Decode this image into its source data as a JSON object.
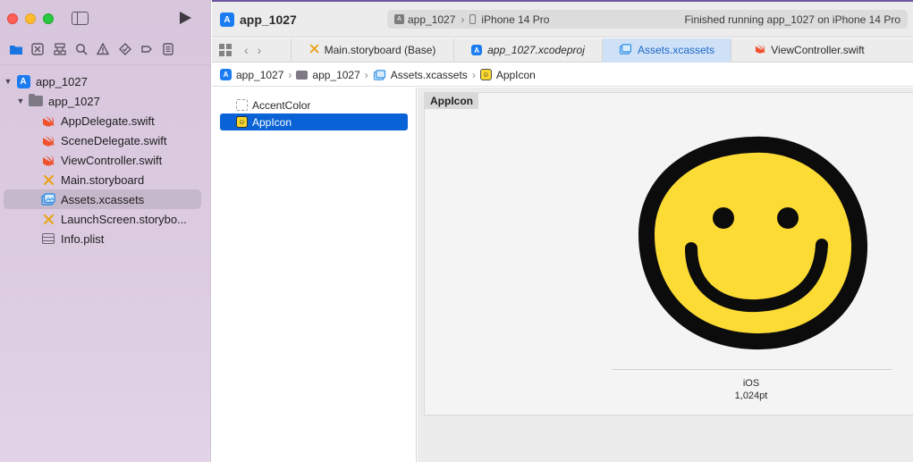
{
  "window": {
    "project_title": "app_1027",
    "scheme_app": "app_1027",
    "scheme_device": "iPhone 14 Pro",
    "status_text": "Finished running app_1027 on iPhone 14 Pro"
  },
  "navigator": {
    "icons": [
      "folder-icon",
      "source-control-icon",
      "hierarchy-icon",
      "search-icon",
      "warning-icon",
      "test-icon",
      "debug-icon",
      "report-icon"
    ],
    "tree": [
      {
        "label": "app_1027",
        "kind": "project",
        "level": 0,
        "disclosure": "open"
      },
      {
        "label": "app_1027",
        "kind": "folder",
        "level": 1,
        "disclosure": "open"
      },
      {
        "label": "AppDelegate.swift",
        "kind": "swift",
        "level": 2
      },
      {
        "label": "SceneDelegate.swift",
        "kind": "swift",
        "level": 2
      },
      {
        "label": "ViewController.swift",
        "kind": "swift",
        "level": 2
      },
      {
        "label": "Main.storyboard",
        "kind": "storyboard",
        "level": 2
      },
      {
        "label": "Assets.xcassets",
        "kind": "assets",
        "level": 2,
        "selected": true
      },
      {
        "label": "LaunchScreen.storybo...",
        "kind": "storyboard",
        "level": 2
      },
      {
        "label": "Info.plist",
        "kind": "plist",
        "level": 2
      }
    ]
  },
  "tabs": [
    {
      "label": "Main.storyboard (Base)",
      "icon": "storyboard-icon",
      "active": false,
      "italic": false
    },
    {
      "label": "app_1027.xcodeproj",
      "icon": "xcodeproj-icon",
      "active": false,
      "italic": true
    },
    {
      "label": "Assets.xcassets",
      "icon": "assets-icon",
      "active": true,
      "italic": false
    },
    {
      "label": "ViewController.swift",
      "icon": "swift-icon",
      "active": false,
      "italic": false
    }
  ],
  "jumpbar": {
    "crumbs": [
      "app_1027",
      "app_1027",
      "Assets.xcassets",
      "AppIcon"
    ]
  },
  "asset_list": {
    "items": [
      {
        "label": "AccentColor",
        "selected": false
      },
      {
        "label": "AppIcon",
        "selected": true
      }
    ]
  },
  "editor": {
    "panel_title": "AppIcon",
    "slot_platform": "iOS",
    "slot_size": "1,024pt",
    "colors": {
      "face": "#fddb35",
      "outline": "#0c0c0c",
      "selection": "#0a63d6",
      "accent_tab": "#cfe1f7"
    }
  }
}
